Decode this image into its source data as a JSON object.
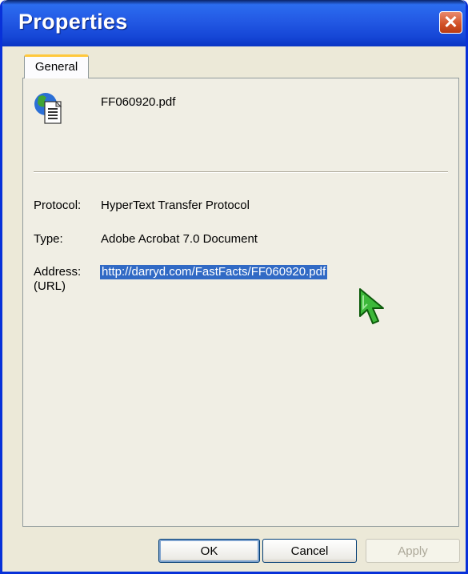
{
  "window": {
    "title": "Properties",
    "close_glyph": "✕"
  },
  "tabs": [
    {
      "label": "General",
      "selected": true
    }
  ],
  "file": {
    "icon": "internet-document-icon",
    "name": "FF060920.pdf"
  },
  "fields": {
    "protocol": {
      "label": "Protocol:",
      "value": "HyperText Transfer Protocol"
    },
    "type": {
      "label": "Type:",
      "value": "Adobe Acrobat 7.0 Document"
    },
    "address": {
      "label_line1": "Address:",
      "label_line2": "(URL)",
      "value": "http://darryd.com/FastFacts/FF060920.pdf",
      "selected": true
    }
  },
  "buttons": {
    "ok": "OK",
    "cancel": "Cancel",
    "apply": "Apply",
    "apply_enabled": false
  },
  "colors": {
    "titlebar": "#2359E4",
    "selection": "#316AC5",
    "tab_highlight": "#FFC83C",
    "close_button": "#D14F25",
    "cursor": "#3DB83A"
  }
}
